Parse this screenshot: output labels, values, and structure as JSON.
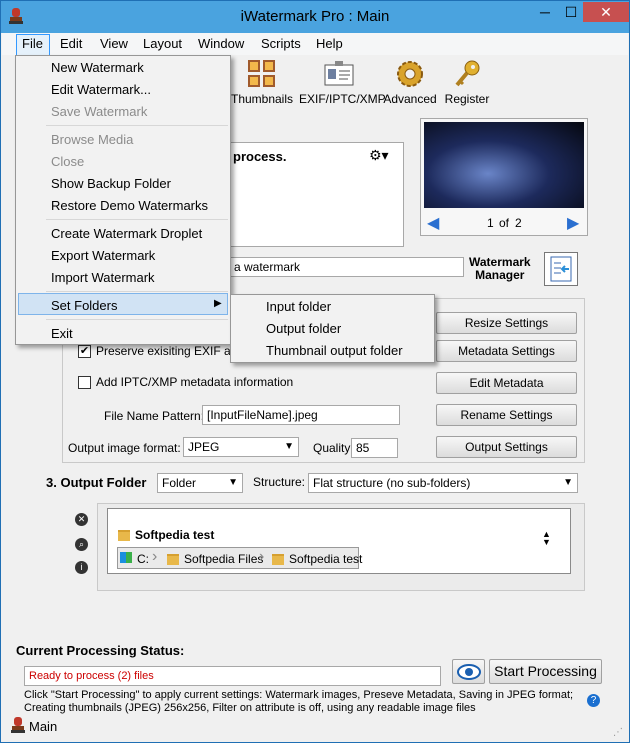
{
  "window": {
    "title": "iWatermark Pro : Main"
  },
  "menubar": [
    "File",
    "Edit",
    "View",
    "Layout",
    "Window",
    "Scripts",
    "Help"
  ],
  "toolbar": {
    "thumbnails": "Thumbnails",
    "exif": "EXIF/IPTC/XMP",
    "advanced": "Advanced",
    "register": "Register"
  },
  "file_menu": {
    "new_watermark": "New Watermark",
    "edit_watermark": "Edit Watermark...",
    "save_watermark": "Save Watermark",
    "browse_media": "Browse Media",
    "close": "Close",
    "show_backup": "Show Backup Folder",
    "restore_demo": "Restore Demo Watermarks",
    "create_droplet": "Create Watermark Droplet",
    "export_watermark": "Export Watermark",
    "import_watermark": "Import Watermark",
    "set_folders": "Set Folders",
    "exit": "Exit"
  },
  "submenu": {
    "input": "Input folder",
    "output": "Output folder",
    "thumbs": "Thumbnail output folder"
  },
  "process_text": "process.",
  "preview": {
    "page": "1",
    "of": "of",
    "total": "2"
  },
  "watermark_field": "a watermark",
  "watermark_manager": "Watermark\nManager",
  "settings": {
    "resize": "Resize Settings",
    "metadata": "Metadata Settings",
    "edit_metadata": "Edit Metadata",
    "rename": "Rename Settings",
    "output": "Output Settings"
  },
  "preserve_exif": "Preserve exisiting EXIF and",
  "add_iptc": "Add IPTC/XMP metadata information",
  "file_name_pattern_label": "File Name Pattern:",
  "file_name_pattern": "[InputFileName].jpeg",
  "output_format_label": "Output image format:",
  "output_format": "JPEG",
  "quality_label": "Quality:",
  "quality": "85",
  "output_folder": {
    "heading": "3. Output Folder",
    "folder_select": "Folder",
    "structure_label": "Structure:",
    "structure": "Flat structure (no sub-folders)",
    "selected": "Softpedia test",
    "path": [
      "C:",
      "Softpedia Files",
      "Softpedia test"
    ]
  },
  "status": {
    "heading": "Current Processing Status:",
    "message": "Ready to process (2) files",
    "start": "Start Processing",
    "info_line1": "Click \"Start Processing\" to apply current settings: Watermark images, Preseve Metadata, Saving in JPEG format;",
    "info_line2": "Creating thumbnails (JPEG) 256x256, Filter on attribute is off, using any readable image files",
    "footer": "Main"
  },
  "colors": {
    "titlebar": "#4aa3df",
    "close": "#c75050",
    "status_red": "#cc0000",
    "accent": "#3399ff"
  }
}
